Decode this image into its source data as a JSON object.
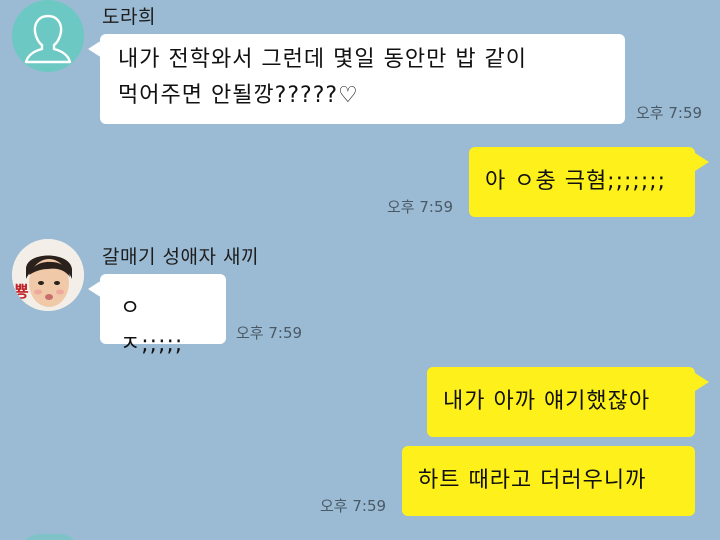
{
  "messages": [
    {
      "sender": "도라희",
      "text_line1": "내가 전학와서 그런데 몇일 동안만 밥 같이",
      "text_line2": "먹어주면 안될깡?????♡",
      "time": "오후 7:59"
    },
    {
      "text": "아 ㅇ충 극혐;;;;;;;",
      "time": "오후 7:59"
    },
    {
      "sender": "갈매기 성애자 새끼",
      "text": "ㅇ ㅈ;;;;;",
      "time": "오후 7:59"
    },
    {
      "text": "내가 아까 얘기했잖아"
    },
    {
      "text": "하트 때라고 더러우니까",
      "time": "오후 7:59"
    }
  ],
  "avatar_sticker_text": "뿅",
  "colors": {
    "background": "#9bbbd4",
    "incoming_bubble": "#ffffff",
    "outgoing_bubble": "#fef01b",
    "default_avatar": "#6cc8c2"
  }
}
